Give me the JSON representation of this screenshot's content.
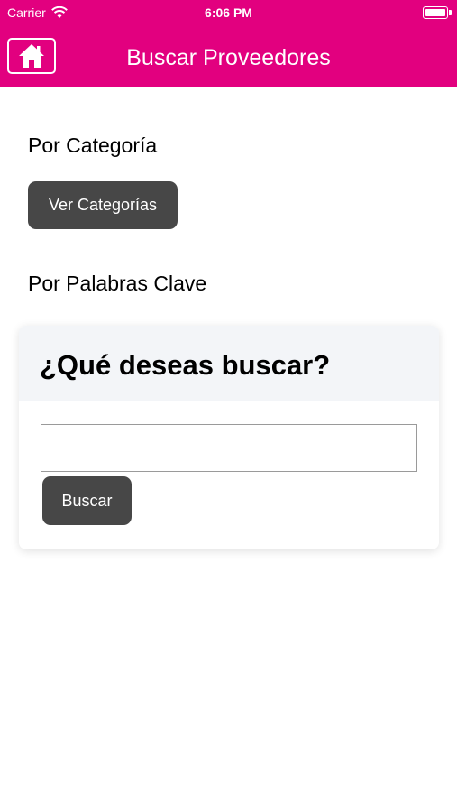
{
  "status_bar": {
    "carrier": "Carrier",
    "time": "6:06 PM",
    "icons": [
      "wifi-icon",
      "battery-icon"
    ]
  },
  "nav_bar": {
    "title": "Buscar Proveedores",
    "home_icon": "home-icon",
    "background_color": "#e2007f"
  },
  "category_section": {
    "label": "Por Categoría",
    "button_label": "Ver Categorías"
  },
  "keyword_section": {
    "label": "Por Palabras Clave",
    "card_title": "¿Qué deseas buscar?",
    "input_value": "",
    "search_button_label": "Buscar"
  },
  "colors": {
    "brand": "#e2007f",
    "button": "#474747",
    "card_header": "#f3f5f8"
  }
}
